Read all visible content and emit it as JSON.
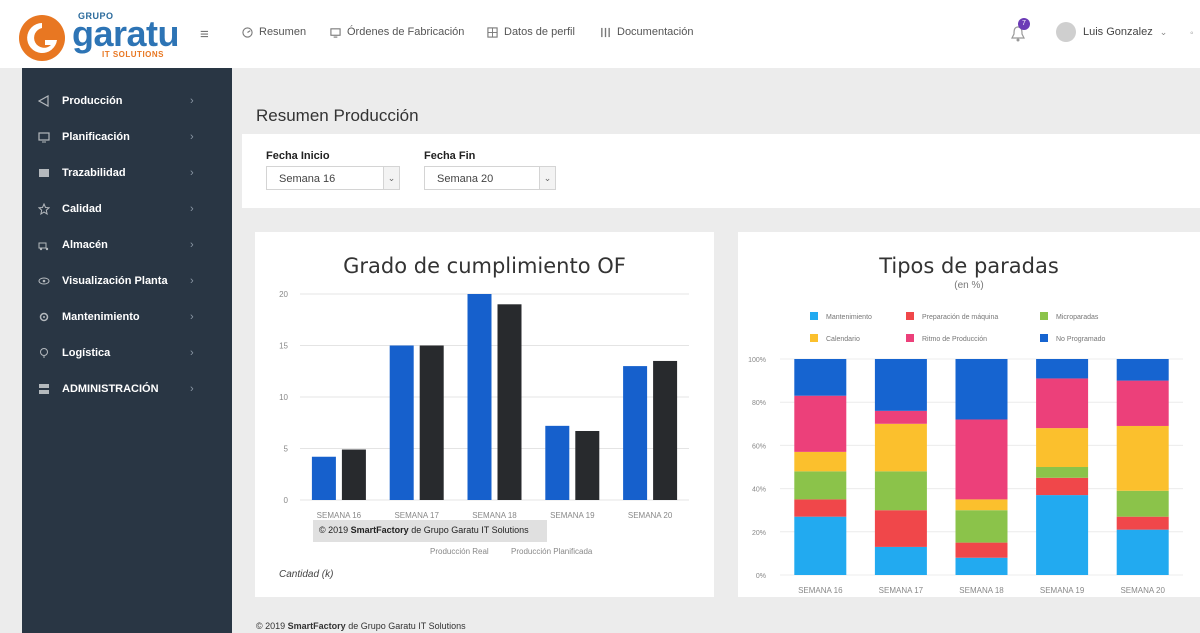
{
  "header": {
    "logo": {
      "grupo": "GRUPO",
      "word": "garatu",
      "sub": "IT SOLUTIONS"
    },
    "nav": [
      {
        "label": "Resumen",
        "icon": "dashboard-icon"
      },
      {
        "label": "Órdenes de Fabricación",
        "icon": "monitor-icon"
      },
      {
        "label": "Datos de perfil",
        "icon": "grid-icon"
      },
      {
        "label": "Documentación",
        "icon": "book-icon"
      }
    ],
    "notifications": {
      "count": "7"
    },
    "user": {
      "name": "Luis Gonzalez"
    }
  },
  "sidebar": {
    "items": [
      {
        "label": "Producción",
        "icon": "production-icon"
      },
      {
        "label": "Planificación",
        "icon": "monitor-icon"
      },
      {
        "label": "Trazabilidad",
        "icon": "trace-icon"
      },
      {
        "label": "Calidad",
        "icon": "star-icon"
      },
      {
        "label": "Almacén",
        "icon": "truck-icon"
      },
      {
        "label": "Visualización Planta",
        "icon": "eye-icon"
      },
      {
        "label": "Mantenimiento",
        "icon": "gear-icon"
      },
      {
        "label": "Logística",
        "icon": "location-icon"
      },
      {
        "label": "ADMINISTRACIÓN",
        "icon": "server-icon"
      }
    ]
  },
  "main": {
    "title": "Resumen Producción",
    "filters": {
      "start": {
        "label": "Fecha Inicio",
        "value": "Semana 16"
      },
      "end": {
        "label": "Fecha Fin",
        "value": "Semana 20"
      }
    }
  },
  "watermark": {
    "prefix": "© 2019 ",
    "brand": "SmartFactory",
    "suffix": " de Grupo Garatu IT Solutions"
  },
  "footer": {
    "prefix": "© 2019 ",
    "brand": "SmartFactory",
    "suffix": " de Grupo Garatu IT Solutions"
  },
  "chart_data": [
    {
      "type": "bar",
      "title": "Grado de cumplimiento OF",
      "ylabel": "Cantidad (k)",
      "categories": [
        "SEMANA 16",
        "SEMANA 17",
        "SEMANA 18",
        "SEMANA 19",
        "SEMANA 20"
      ],
      "ylim": [
        0,
        20
      ],
      "yticks": [
        0,
        5,
        10,
        15,
        20
      ],
      "grid": true,
      "legend": "bottom",
      "series": [
        {
          "name": "Producción Real",
          "color": "#1660cc",
          "values": [
            4.2,
            15,
            20,
            7.2,
            13
          ]
        },
        {
          "name": "Producción Planificada",
          "color": "#282a2d",
          "values": [
            4.9,
            15,
            19,
            6.7,
            13.5
          ]
        }
      ]
    },
    {
      "type": "bar",
      "stacked": true,
      "title": "Tipos de paradas",
      "subtitle": "(en %)",
      "categories": [
        "SEMANA 16",
        "SEMANA 17",
        "SEMANA 18",
        "SEMANA 19",
        "SEMANA 20"
      ],
      "ylim": [
        0,
        100
      ],
      "yticks": [
        "0%",
        "20%",
        "40%",
        "60%",
        "80%",
        "100%"
      ],
      "grid": true,
      "legend": "top",
      "series": [
        {
          "name": "Mantenimiento",
          "color": "#22aaf0",
          "values": [
            27,
            13,
            8,
            37,
            21
          ]
        },
        {
          "name": "Preparación de máquina",
          "color": "#f0474a",
          "values": [
            8,
            17,
            7,
            8,
            6
          ]
        },
        {
          "name": "Microparadas",
          "color": "#8bc34a",
          "values": [
            13,
            18,
            15,
            5,
            12
          ]
        },
        {
          "name": "Calendario",
          "color": "#fbc02d",
          "values": [
            9,
            22,
            5,
            18,
            30
          ]
        },
        {
          "name": "Ritmo de Producción",
          "color": "#ec407a",
          "values": [
            26,
            6,
            37,
            23,
            21
          ]
        },
        {
          "name": "No Programado",
          "color": "#1664d0",
          "values": [
            17,
            24,
            28,
            9,
            10
          ]
        }
      ]
    }
  ]
}
